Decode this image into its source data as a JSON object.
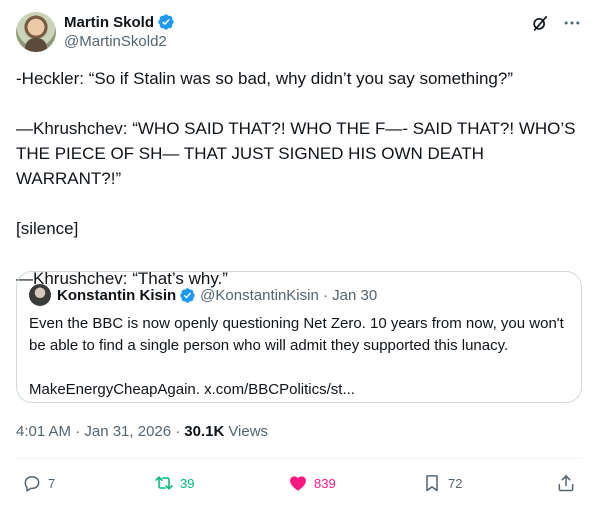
{
  "author": {
    "display_name": "Martin Skold",
    "handle": "@MartinSkold2"
  },
  "icons": {
    "verified": "verified-badge-icon",
    "grok": "grok-icon",
    "more": "more-options-icon",
    "reply": "reply-icon",
    "repost": "repost-icon",
    "like": "heart-icon",
    "bookmark": "bookmark-icon",
    "share": "share-icon"
  },
  "colors": {
    "verified": "#1d9bf0",
    "repost_active": "#00ba7c",
    "like_active": "#f91880",
    "secondary_text": "#536471"
  },
  "tweet": {
    "paragraphs": [
      "-Heckler: “So if Stalin was so bad, why didn’t you say something?”",
      "—Khrushchev: “WHO SAID THAT?! WHO THE F—- SAID THAT?! WHO’S THE PIECE OF SH— THAT JUST SIGNED HIS OWN DEATH WARRANT?!”",
      "[silence]",
      "—Khrushchev: “That’s why.”"
    ],
    "timestamp": "4:01 AM · Jan 31, 2026 ·",
    "views_count": "30.1K",
    "views_label": "Views"
  },
  "quote": {
    "display_name": "Konstantin Kisin",
    "handle_date": "@KonstantinKisin · Jan 30",
    "paragraphs": [
      "Even the BBC is now openly questioning Net Zero. 10 years from now, you won't be able to find a single person who will admit they supported this lunacy.",
      "MakeEnergyCheapAgain. x.com/BBCPolitics/st..."
    ]
  },
  "metrics": {
    "replies": "7",
    "reposts": "39",
    "likes": "839",
    "bookmarks": "72"
  }
}
